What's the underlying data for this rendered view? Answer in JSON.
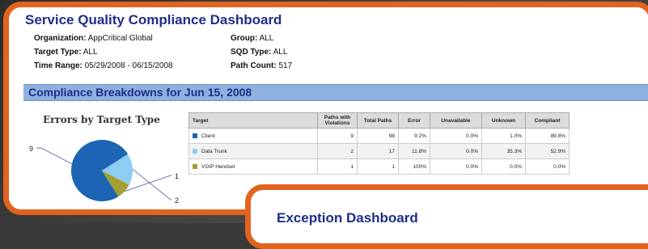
{
  "dashboard": {
    "title": "Service Quality Compliance Dashboard",
    "org_label": "Organization:",
    "org_value": "AppCritical Global",
    "target_type_label": "Target Type:",
    "target_type_value": "ALL",
    "time_range_label": "Time Range:",
    "time_range_value": "05/29/2008 - 06/15/2008",
    "group_label": "Group:",
    "group_value": "ALL",
    "sqd_label": "SQD Type:",
    "sqd_value": "ALL",
    "path_count_label": "Path Count:",
    "path_count_value": "517"
  },
  "section": {
    "title": "Compliance Breakdowns for Jun 15, 2008"
  },
  "chart_data": {
    "type": "pie",
    "title": "Errors by Target Type",
    "slices": [
      {
        "label": "9",
        "value": 9,
        "color": "#1e64b4"
      },
      {
        "label": "2",
        "value": 2,
        "color": "#8ecdf2"
      },
      {
        "label": "1",
        "value": 1,
        "color": "#a3a030"
      }
    ]
  },
  "table": {
    "headers": [
      "Target",
      "Paths with Violations",
      "Total Paths",
      "Error",
      "Unavailable",
      "Unknown",
      "Compliant"
    ],
    "rows": [
      {
        "target": "Client",
        "color": "#1e64b4",
        "cells": [
          "9",
          "98",
          "9.2%",
          "0.0%",
          "1.0%",
          "89.8%"
        ]
      },
      {
        "target": "Data Trunk",
        "color": "#8ecdf2",
        "cells": [
          "2",
          "17",
          "11.8%",
          "0.0%",
          "35.3%",
          "52.9%"
        ]
      },
      {
        "target": "VOIP Handset",
        "color": "#a3a030",
        "cells": [
          "1",
          "1",
          "100%",
          "0.0%",
          "0.0%",
          "0.0%"
        ]
      }
    ]
  },
  "exception": {
    "title": "Exception Dashboard"
  }
}
